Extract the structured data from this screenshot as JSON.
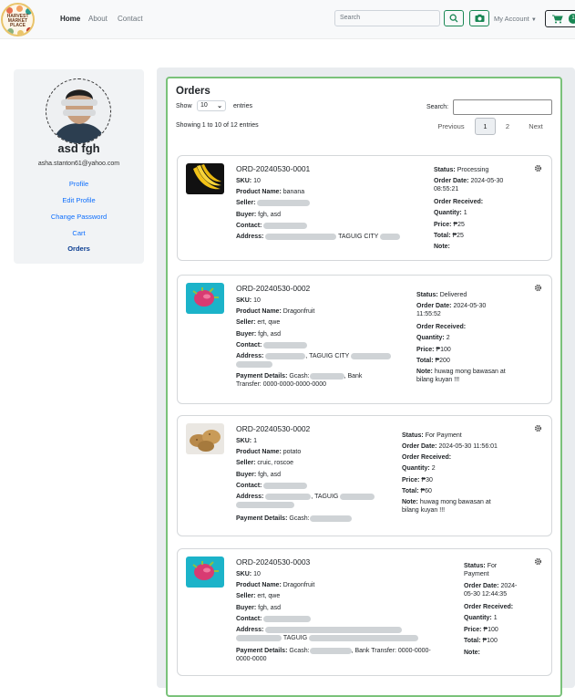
{
  "nav": {
    "logo_text": "HARVEST MARKET PLACE",
    "home": "Home",
    "about": "About",
    "contact": "Contact",
    "search_placeholder": "Search",
    "account": "My Account",
    "cart_count": "1"
  },
  "profile": {
    "name": "asd fgh",
    "email": "asha.stanton61@yahoo.com",
    "links": [
      "Profile",
      "Edit Profile",
      "Change Password",
      "Cart",
      "Orders"
    ]
  },
  "orders": {
    "title": "Orders",
    "show_label": "Show",
    "show_value": "10",
    "entries_label": "entries",
    "search_label": "Search:",
    "info": "Showing 1 to 10 of 12 entries",
    "pagination": {
      "previous": "Previous",
      "page1": "1",
      "page2": "2",
      "next": "Next"
    },
    "labels": {
      "sku": "SKU:",
      "product": "Product Name:",
      "seller": "Seller:",
      "buyer": "Buyer:",
      "contact": "Contact:",
      "address": "Address:",
      "payment": "Payment Details:",
      "status": "Status:",
      "order_date": "Order Date:",
      "received": "Order Received:",
      "quantity": "Quantity:",
      "price": "Price:",
      "total": "Total:",
      "note": "Note:"
    },
    "items": [
      {
        "id": "ORD-20240530-0001",
        "sku": "10",
        "product": "banana",
        "buyer": "fgh, asd",
        "address_city": "TAGUIG CITY",
        "status": "Processing",
        "order_date": "2024-05-30",
        "order_time": "08:55:21",
        "quantity": "1",
        "price": "₱25",
        "total": "₱25",
        "note": ""
      },
      {
        "id": "ORD-20240530-0002",
        "sku": "10",
        "product": "Dragonfruit",
        "seller": "ert, qwe",
        "buyer": "fgh, asd",
        "address_city": "TAGUIG CITY",
        "payment_prefix": "Gcash:",
        "payment_mid": ", Bank",
        "payment_line2": "Transfer: 0000-0000-0000-0000",
        "status": "Delivered",
        "order_date": "2024-05-30",
        "order_time": "11:55:52",
        "quantity": "2",
        "price": "₱100",
        "total": "₱200",
        "note": "huwag mong bawasan at",
        "note2": "bilang kuyan !!!"
      },
      {
        "id": "ORD-20240530-0002",
        "sku": "1",
        "product": "potato",
        "seller": "cruic, roscoe",
        "buyer": "fgh, asd",
        "address_city": "TAGUIG",
        "payment_prefix": "Gcash:",
        "status": "For Payment",
        "order_date": "2024-05-30 11:56:01",
        "quantity": "2",
        "price": "₱30",
        "total": "₱60",
        "note": "huwag mong bawasan at",
        "note2": "bilang kuyan !!!"
      },
      {
        "id": "ORD-20240530-0003",
        "sku": "10",
        "product": "Dragonfruit",
        "seller": "ert, qwe",
        "buyer": "fgh, asd",
        "address_city": "TAGUIG",
        "payment_prefix": "Gcash:",
        "payment_mid": ", Bank Transfer: 0000-0000-",
        "payment_line2": "0000-0000",
        "status": "For",
        "status2": "Payment",
        "order_date": "2024-",
        "order_date2": "05-30 12:44:35",
        "quantity": "1",
        "price": "₱100",
        "total": "₱100",
        "note": ""
      }
    ]
  },
  "colors": {
    "green": "#198754",
    "link": "#0d6efd",
    "panel_border": "#7ac27a"
  }
}
